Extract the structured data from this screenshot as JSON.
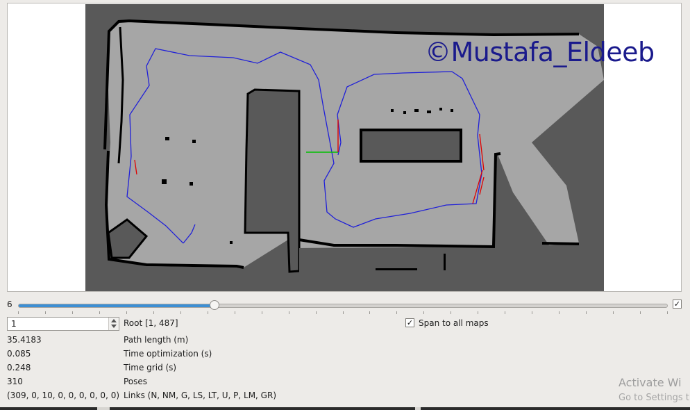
{
  "watermark": "©Mustafa_Eldeeb",
  "slider": {
    "value_label": "6",
    "position": 0.302
  },
  "span_checkbox_top": {
    "checked": "✓"
  },
  "node_spinbox": {
    "value": "1"
  },
  "root_label": "Root [1, 487]",
  "span_to_all_maps": {
    "label": "Span to all maps",
    "checked": "✓"
  },
  "stats": [
    {
      "value": "35.4183",
      "label": "Path length (m)"
    },
    {
      "value": "0.085",
      "label": "Time optimization (s)"
    },
    {
      "value": "0.248",
      "label": "Time grid (s)"
    },
    {
      "value": "310",
      "label": "Poses"
    },
    {
      "value": "(309, 0, 10, 0, 0, 0, 0, 0, 0)",
      "label": "Links (N, NM, G, LS, LT, U, P, LM, GR)"
    }
  ],
  "activation": {
    "title": "Activate Wi",
    "subtitle": "Go to Settings t"
  },
  "colors": {
    "unknown": "#595959",
    "free": "#a6a6a6",
    "obstacle": "#000000",
    "path": "#2020d8",
    "loop_links": "#e00000",
    "axis_x": "#00c000",
    "axis_y": "#e00000",
    "accent": "#3d8fd4",
    "watermark": "#1a1a8c"
  }
}
